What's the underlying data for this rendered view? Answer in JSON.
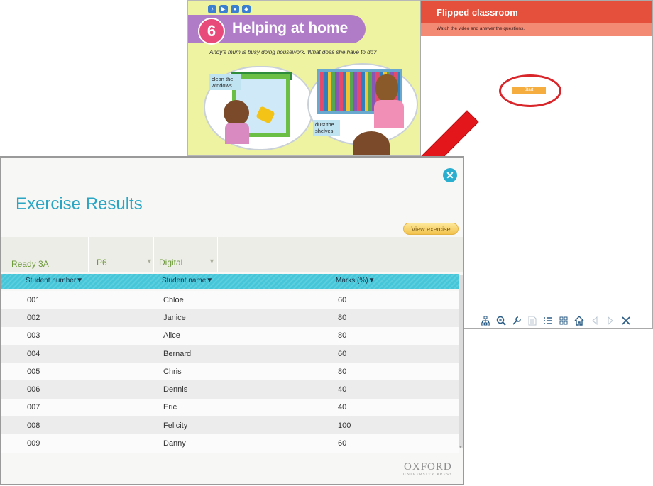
{
  "textbook": {
    "unit_number": "6",
    "unit_title": "Helping at home",
    "intro": "Andy's mum is busy doing housework. What does she have to do?",
    "labels": [
      "clean the windows",
      "dust the shelves"
    ]
  },
  "flipped": {
    "title": "Flipped classroom",
    "instruction": "Watch the video and answer the questions.",
    "start_label": "Start",
    "toolbar_icons": [
      "sitemap-icon",
      "zoom-icon",
      "wrench-icon",
      "document-icon",
      "list-icon",
      "grid-icon",
      "home-icon",
      "prev-icon",
      "next-icon",
      "close-icon"
    ]
  },
  "dialog": {
    "title": "Exercise Results",
    "view_exercise_label": "View exercise",
    "filters": {
      "book": "Ready 3A",
      "class": "P6",
      "mode": "Digital"
    },
    "columns": [
      "Student number",
      "Student name",
      "Marks (%)"
    ],
    "rows": [
      {
        "number": "001",
        "name": "Chloe",
        "marks": "60"
      },
      {
        "number": "002",
        "name": "Janice",
        "marks": "80"
      },
      {
        "number": "003",
        "name": "Alice",
        "marks": "80"
      },
      {
        "number": "004",
        "name": "Bernard",
        "marks": "60"
      },
      {
        "number": "005",
        "name": "Chris",
        "marks": "80"
      },
      {
        "number": "006",
        "name": "Dennis",
        "marks": "40"
      },
      {
        "number": "007",
        "name": "Eric",
        "marks": "40"
      },
      {
        "number": "008",
        "name": "Felicity",
        "marks": "100"
      },
      {
        "number": "009",
        "name": "Danny",
        "marks": "60"
      }
    ],
    "logo": {
      "main": "OXFORD",
      "sub": "UNIVERSITY PRESS"
    }
  },
  "colors": {
    "accent": "#2aa6c4",
    "header_red": "#e4503b",
    "arrow": "#e3171b",
    "table_header": "#46c7d9"
  }
}
